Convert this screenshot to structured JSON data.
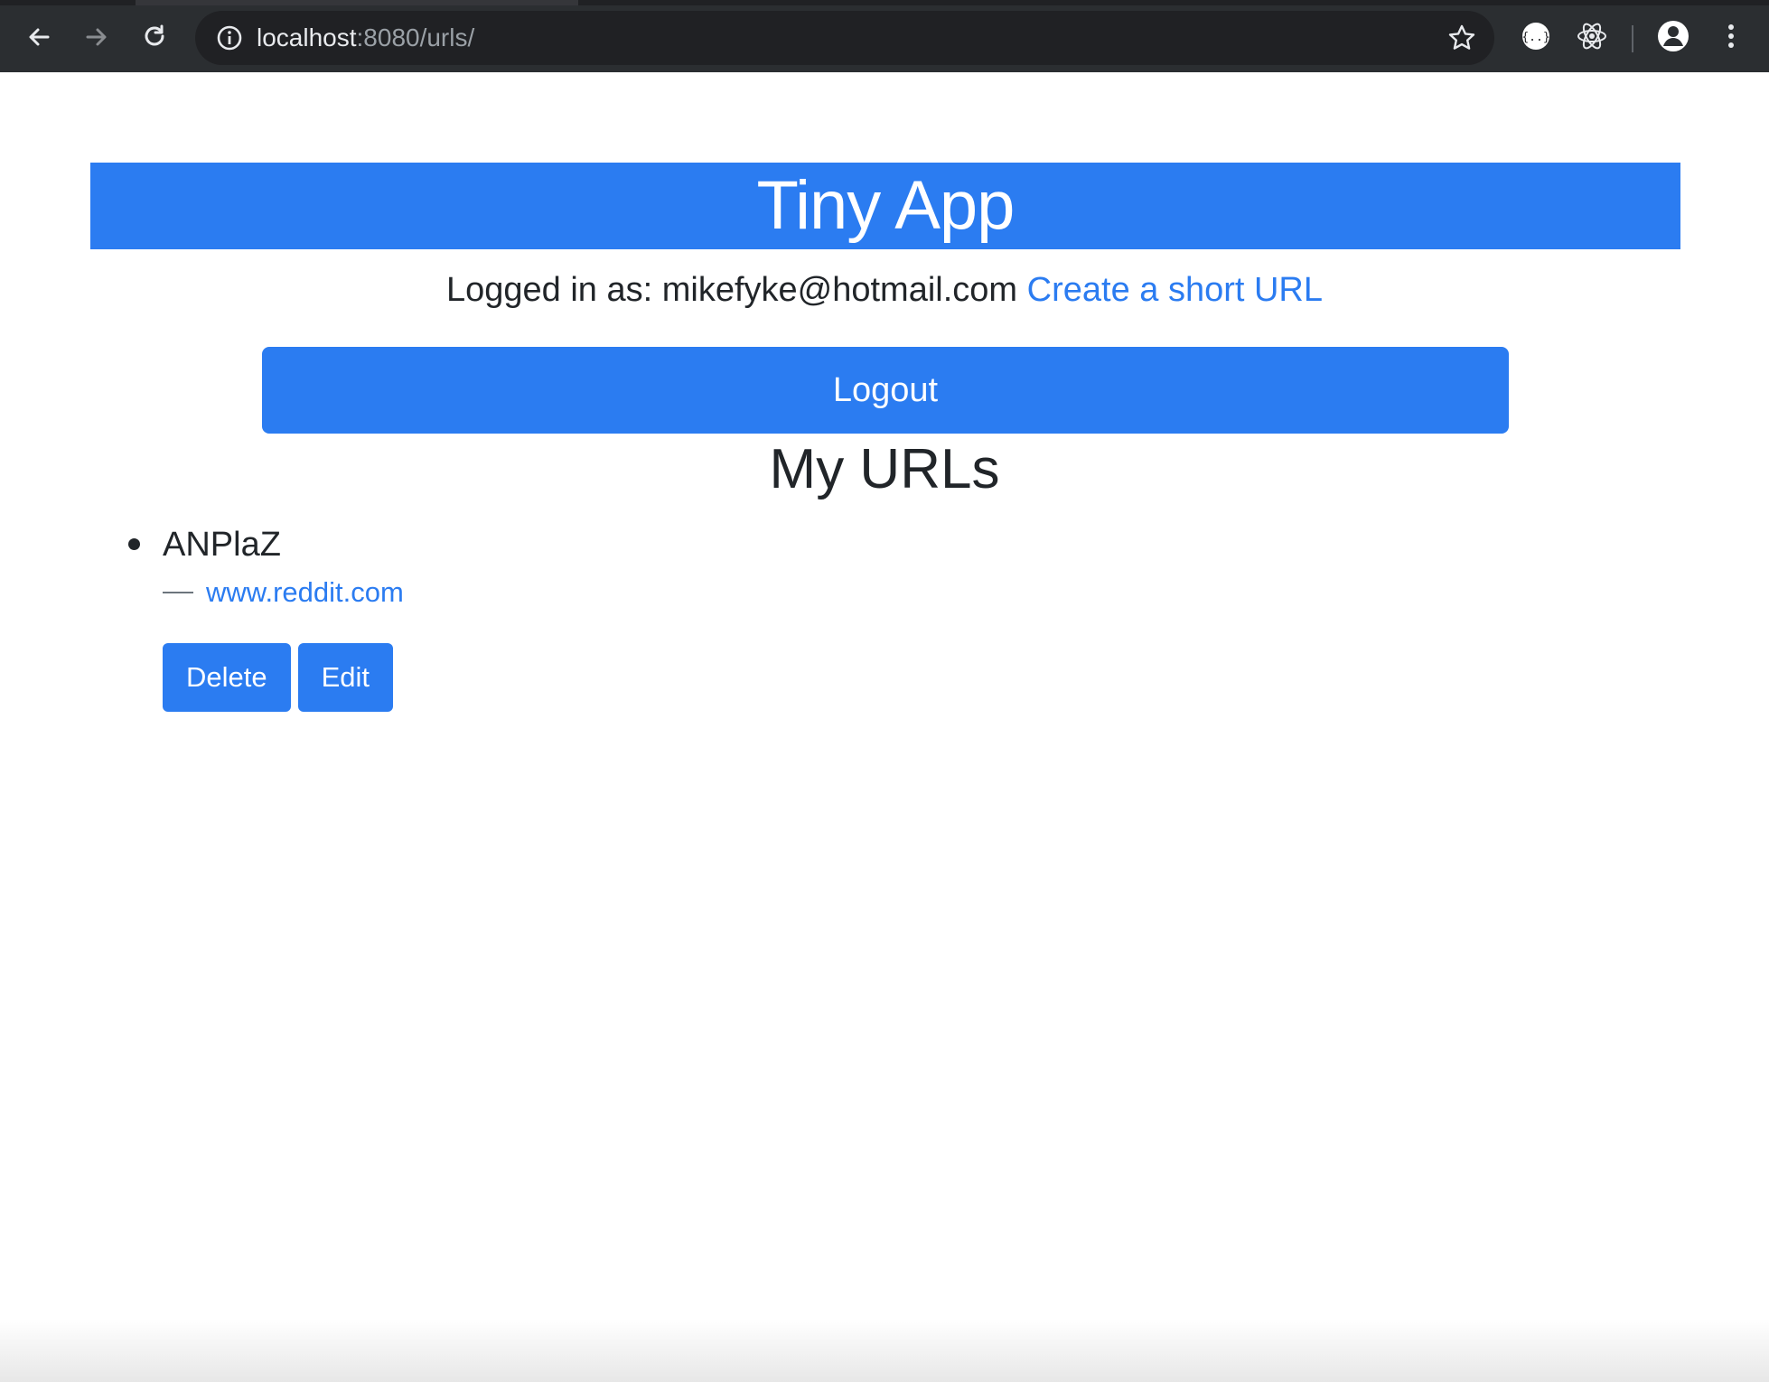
{
  "browser": {
    "url_host": "localhost",
    "url_rest": ":8080/urls/",
    "icons": {
      "back": "back-arrow-icon",
      "forward": "forward-arrow-icon",
      "reload": "reload-icon",
      "info": "info-icon",
      "bookmark": "star-icon",
      "extension_json": "json-extension-icon",
      "extension_react": "react-extension-icon",
      "profile": "profile-icon",
      "menu": "kebab-menu-icon"
    }
  },
  "app": {
    "title": "Tiny App",
    "logged_in_prefix": "Logged in as:",
    "user_email": "mikefyke@hotmail.com",
    "create_link": "Create a short URL",
    "logout_label": "Logout",
    "section_title": "My URLs"
  },
  "urls": [
    {
      "short": "ANPlaZ",
      "long": "www.reddit.com",
      "delete_label": "Delete",
      "edit_label": "Edit"
    }
  ],
  "colors": {
    "primary": "#2b7cf1",
    "text": "#212529",
    "muted": "#6c757d",
    "chrome_bg": "#2b2e31"
  }
}
